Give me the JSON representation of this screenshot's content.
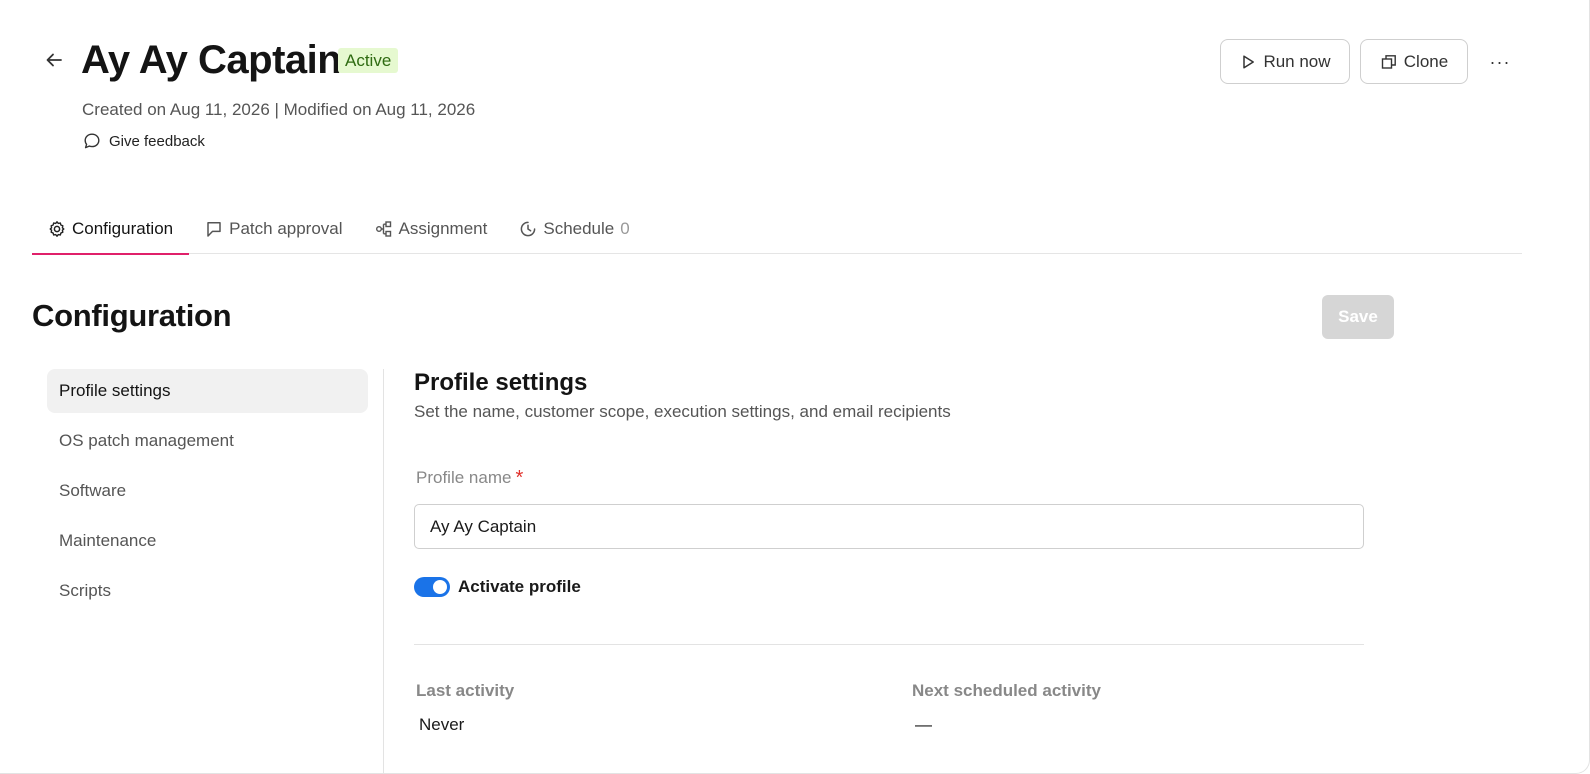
{
  "header": {
    "title": "Ay Ay Captain",
    "status": "Active",
    "meta": "Created on Aug 11, 2026 | Modified on Aug 11, 2026",
    "feedback_label": "Give feedback",
    "run_now_label": "Run now",
    "clone_label": "Clone",
    "more_label": "···"
  },
  "tabs": [
    {
      "label": "Configuration",
      "icon": "gear-icon",
      "active": true
    },
    {
      "label": "Patch approval",
      "icon": "flag-icon"
    },
    {
      "label": "Assignment",
      "icon": "nodes-icon"
    },
    {
      "label": "Schedule",
      "icon": "clock-icon",
      "count": "0"
    }
  ],
  "section": {
    "title": "Configuration",
    "save_label": "Save"
  },
  "sidenav": {
    "items": [
      {
        "label": "Profile settings",
        "active": true
      },
      {
        "label": "OS patch management"
      },
      {
        "label": "Software"
      },
      {
        "label": "Maintenance"
      },
      {
        "label": "Scripts"
      }
    ]
  },
  "profile": {
    "title": "Profile settings",
    "subtitle": "Set the name, customer scope, execution settings, and email recipients",
    "name_label": "Profile name",
    "required_mark": "*",
    "name_value": "Ay Ay Captain",
    "activate_label": "Activate profile",
    "activate_on": true,
    "last_activity_label": "Last activity",
    "last_activity_value": "Never",
    "next_activity_label": "Next scheduled activity",
    "next_activity_value": "—"
  },
  "colors": {
    "accent_tab": "#e0206a",
    "toggle_on": "#1a73e8",
    "badge_bg": "#e6f9d0",
    "badge_text": "#2f6b12"
  }
}
